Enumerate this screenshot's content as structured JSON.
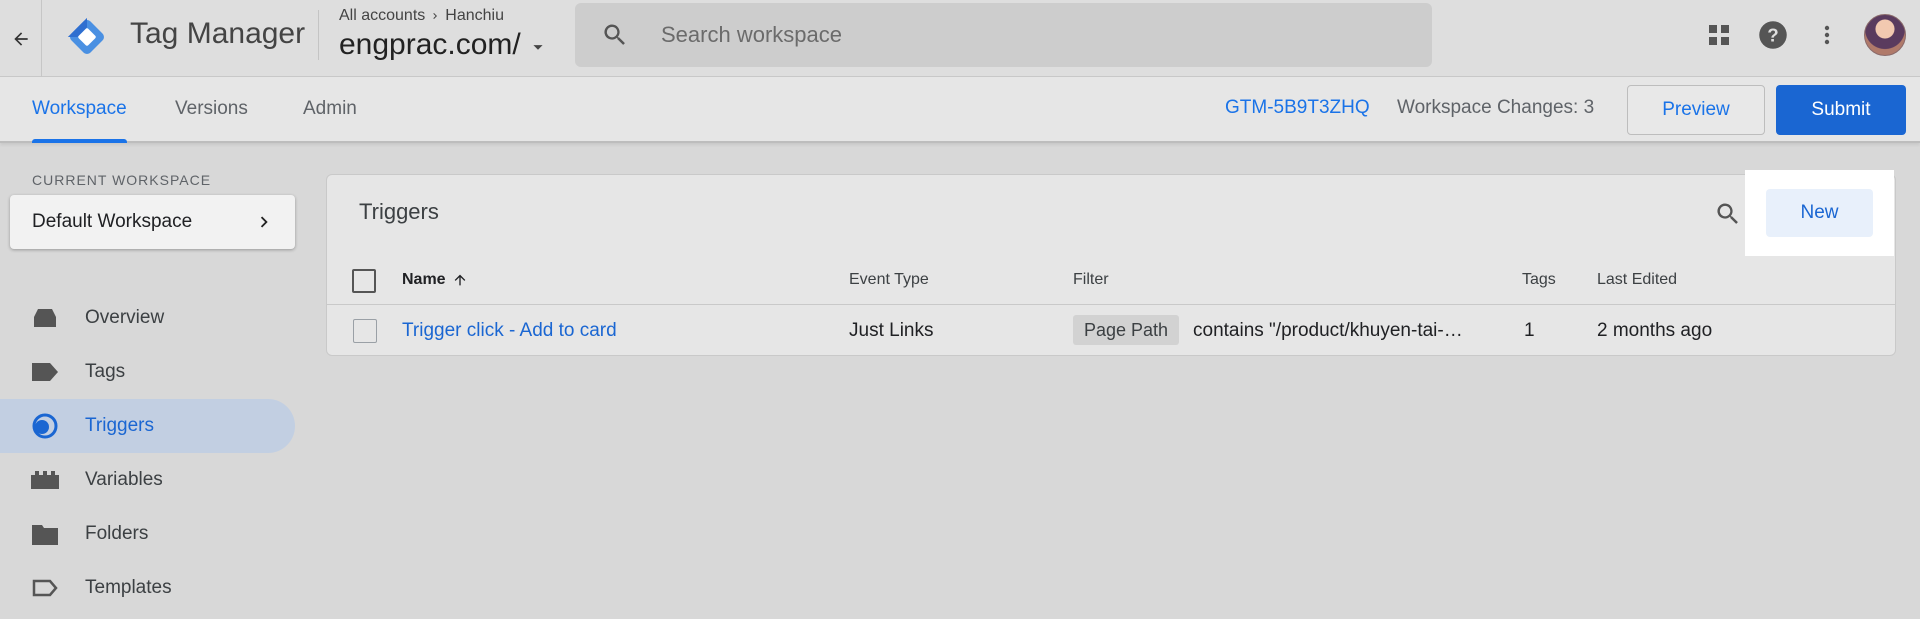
{
  "app": {
    "title": "Tag Manager"
  },
  "breadcrumb": {
    "root": "All accounts",
    "account": "Hanchiu"
  },
  "container": {
    "name": "engprac.com/"
  },
  "search": {
    "placeholder": "Search workspace"
  },
  "icons": {
    "back": "arrow-left-icon",
    "logo": "tag-manager-logo",
    "search": "search-icon",
    "apps": "apps-grid-icon",
    "help": "help-icon",
    "more": "more-vert-icon",
    "dropdown": "caret-down-icon"
  },
  "nav_tabs": [
    {
      "label": "Workspace",
      "active": true
    },
    {
      "label": "Versions",
      "active": false
    },
    {
      "label": "Admin",
      "active": false
    }
  ],
  "header_right": {
    "container_id": "GTM-5B9T3ZHQ",
    "workspace_changes": "Workspace Changes: 3",
    "preview_label": "Preview",
    "submit_label": "Submit"
  },
  "sidebar": {
    "current_workspace_label": "CURRENT WORKSPACE",
    "workspace_name": "Default Workspace",
    "items": [
      {
        "label": "Overview",
        "icon": "overview-icon",
        "active": false
      },
      {
        "label": "Tags",
        "icon": "tag-icon",
        "active": false
      },
      {
        "label": "Triggers",
        "icon": "trigger-icon",
        "active": true
      },
      {
        "label": "Variables",
        "icon": "variables-icon",
        "active": false
      },
      {
        "label": "Folders",
        "icon": "folder-icon",
        "active": false
      },
      {
        "label": "Templates",
        "icon": "template-icon",
        "active": false
      }
    ]
  },
  "triggers": {
    "title": "Triggers",
    "new_label": "New",
    "columns": [
      "Name",
      "Event Type",
      "Filter",
      "Tags",
      "Last Edited"
    ],
    "rows": [
      {
        "name": "Trigger click - Add to card",
        "event_type": "Just Links",
        "filter_chip": "Page Path",
        "filter_text": "contains \"/product/khuyen-tai-…",
        "tags": "1",
        "last_edited": "2 months ago"
      }
    ]
  },
  "colors": {
    "accent": "#1a73e8",
    "submit_bg": "#1a66d2",
    "active_nav_bg": "#c2cfe2",
    "background": "#d8d8d8"
  }
}
